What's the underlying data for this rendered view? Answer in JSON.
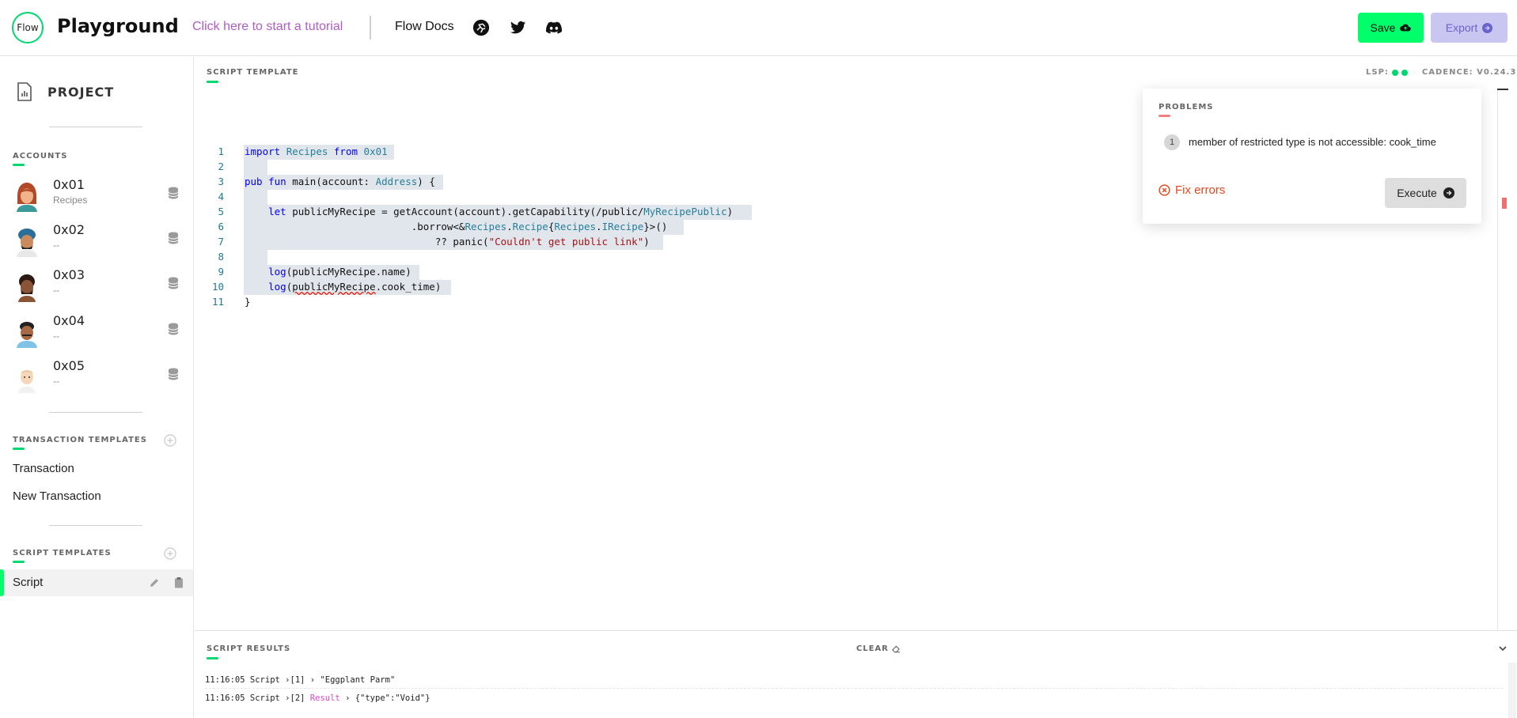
{
  "header": {
    "logo_text": "Flow",
    "title": "Playground",
    "tutorial_link": "Click here to start a tutorial",
    "docs_link": "Flow Docs",
    "icons": [
      "flow-runner-icon",
      "twitter-icon",
      "discord-icon"
    ],
    "save_label": "Save",
    "export_label": "Export"
  },
  "sidebar": {
    "project_label": "PROJECT",
    "accounts_label": "ACCOUNTS",
    "accounts": [
      {
        "address": "0x01",
        "name": "Recipes"
      },
      {
        "address": "0x02",
        "name": "--"
      },
      {
        "address": "0x03",
        "name": "--"
      },
      {
        "address": "0x04",
        "name": "--"
      },
      {
        "address": "0x05",
        "name": "--"
      }
    ],
    "transaction_templates_label": "TRANSACTION TEMPLATES",
    "transactions": [
      "Transaction",
      "New Transaction"
    ],
    "script_templates_label": "SCRIPT TEMPLATES",
    "scripts": [
      "Script"
    ]
  },
  "editor": {
    "label": "SCRIPT TEMPLATE",
    "lsp_label": "LSP:",
    "cadence_label": "CADENCE: V0.24.3"
  },
  "problems": {
    "label": "PROBLEMS",
    "count": "1",
    "message": "member of restricted type is not accessible: cook_time",
    "fix_label": "Fix errors",
    "execute_label": "Execute"
  },
  "results": {
    "label": "SCRIPT RESULTS",
    "clear_label": "CLEAR",
    "lines": [
      {
        "time": "11:16:05",
        "source": "Script",
        "index": "[1]",
        "tag": "",
        "value": "\"Eggplant Parm\""
      },
      {
        "time": "11:16:05",
        "source": "Script",
        "index": "[2]",
        "tag": "Result",
        "value": "{\"type\":\"Void\"}"
      }
    ]
  },
  "colors": {
    "accent_green": "#00ff6a",
    "export_bg": "#c9c6f2",
    "error": "#e5481e",
    "tutorial": "#b05cc8"
  }
}
